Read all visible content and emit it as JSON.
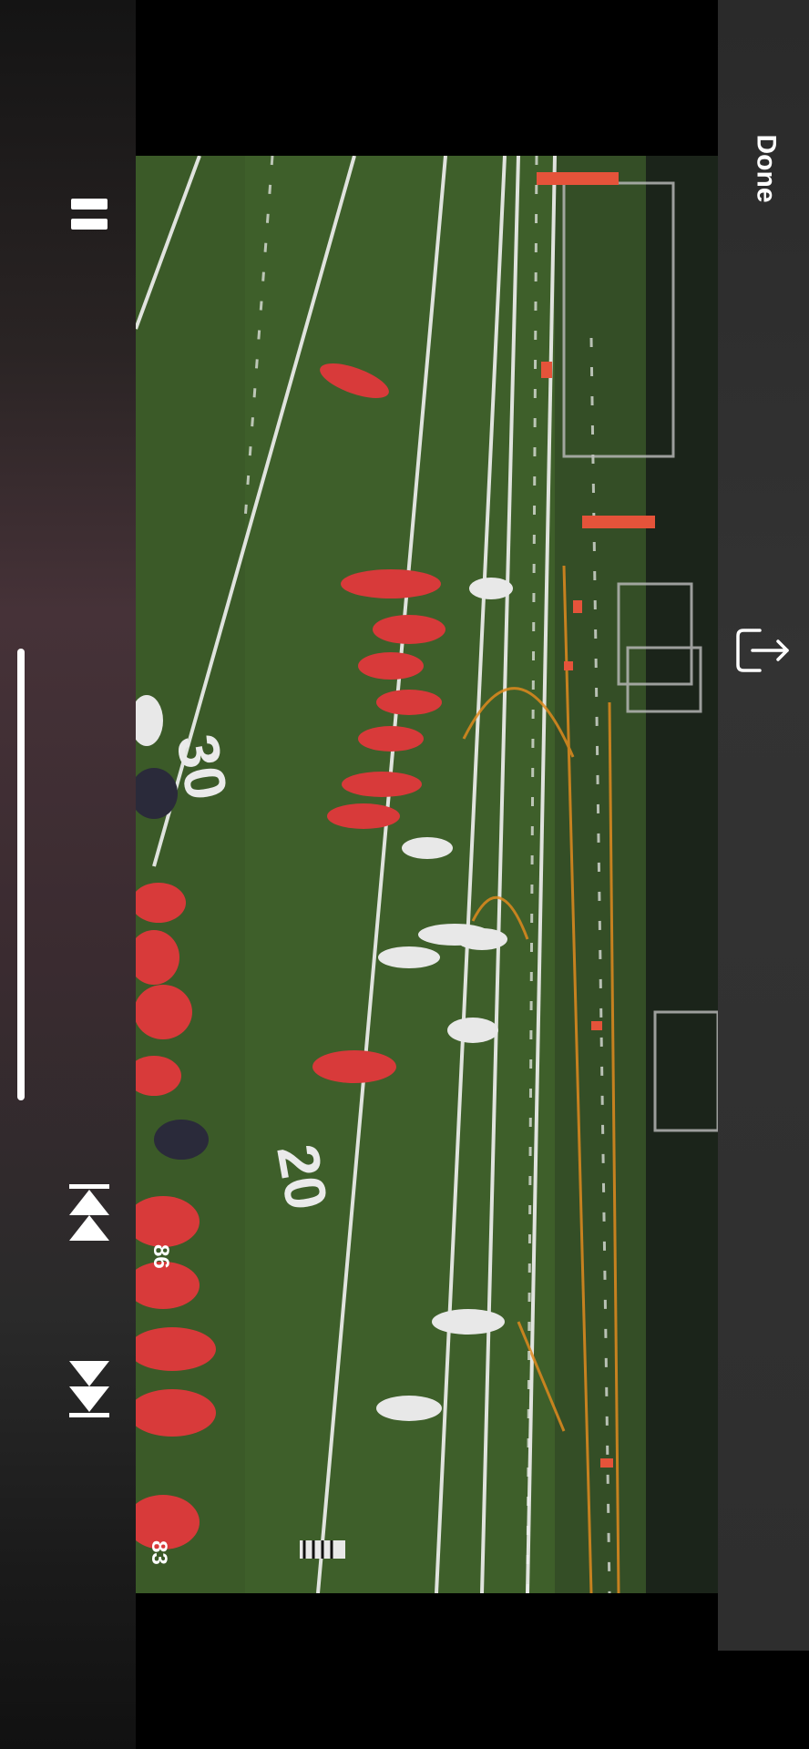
{
  "player": {
    "done_label": "Done",
    "icons": {
      "done": "done-button",
      "share": "share-icon",
      "pause": "pause-icon",
      "skip_back": "skip-back-icon",
      "skip_forward": "skip-forward-icon"
    },
    "volume_level": 1.0
  },
  "video": {
    "yard_numbers": [
      "30",
      "20"
    ],
    "jersey_numbers": [
      "86",
      "83"
    ],
    "colors": {
      "turf": "#456a2e",
      "home_jersey": "#d83a3a",
      "away_jersey": "#e8e8e8",
      "yard_line": "#ffffff",
      "orange_marking": "#e08a1e"
    }
  }
}
